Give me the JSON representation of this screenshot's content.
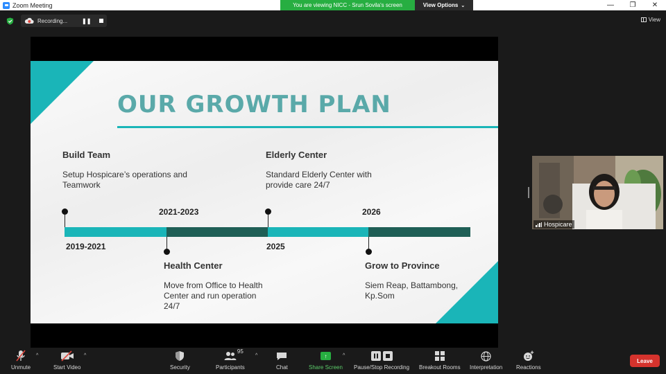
{
  "window": {
    "title": "Zoom Meeting",
    "viewing_banner": "You are viewing NICC - Srun Sovila's screen",
    "view_options_label": "View Options",
    "minimize": "—",
    "restore": "❐",
    "close": "✕"
  },
  "meeting_bar": {
    "recording_label": "Recording...",
    "pause_symbol": "❚❚",
    "view_label": "View"
  },
  "slide": {
    "title": "OUR GROWTH PLAN",
    "milestones": [
      {
        "heading": "Build Team",
        "description": "Setup Hospicare’s operations and Teamwork",
        "year": "2019-2021"
      },
      {
        "heading": "Health Center",
        "description": "Move from Office to Health Center and run operation 24/7",
        "year": "2021-2023"
      },
      {
        "heading": "Elderly Center",
        "description": "Standard Elderly Center with provide care 24/7",
        "year": "2025"
      },
      {
        "heading": "Grow to Province",
        "description": "Siem Reap, Battambong, Kp.Som",
        "year": "2026"
      }
    ],
    "accent_color": "#1ab5b8",
    "dark_color": "#1f5f56"
  },
  "participant": {
    "name": "Hospicare"
  },
  "toolbar": {
    "unmute": "Unmute",
    "start_video": "Start Video",
    "security": "Security",
    "participants": "Participants",
    "participants_count": "95",
    "chat": "Chat",
    "share_screen": "Share Screen",
    "recording_control": "Pause/Stop Recording",
    "breakout_rooms": "Breakout Rooms",
    "interpretation": "Interpretation",
    "reactions": "Reactions",
    "leave": "Leave",
    "caret": "^"
  }
}
